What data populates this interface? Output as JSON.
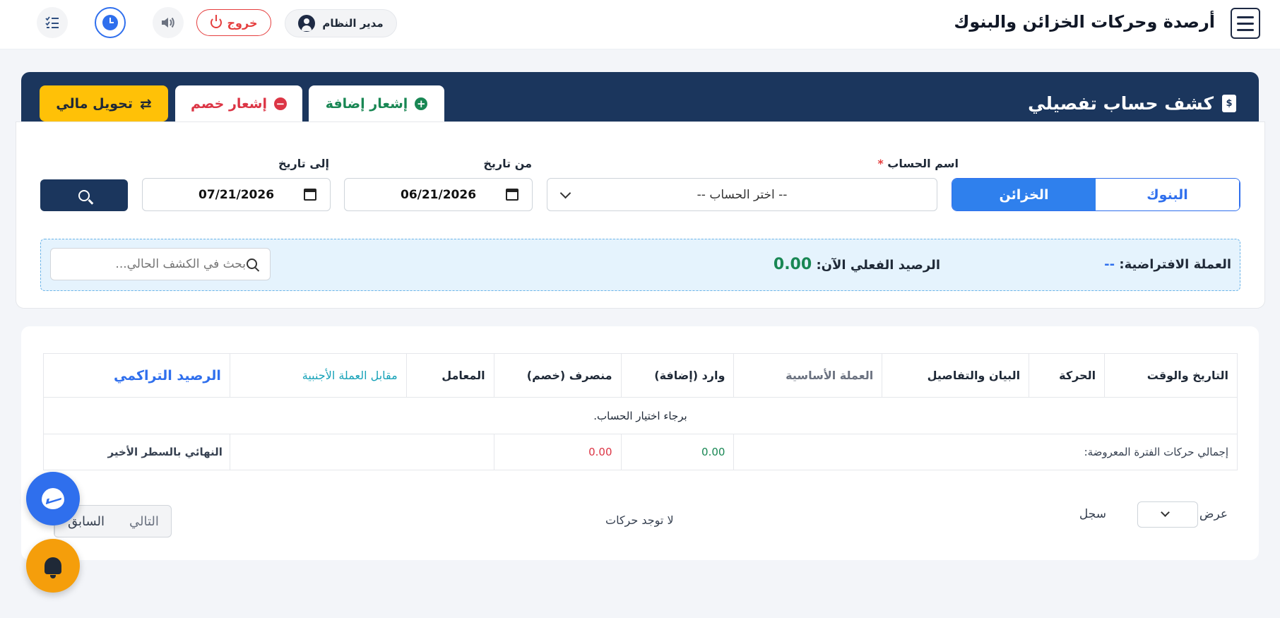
{
  "topbar": {
    "title": "أرصدة وحركات الخزائن والبنوك",
    "user_label": "مدير النظام",
    "logout_label": "خروج"
  },
  "header": {
    "section_title": "كشف حساب تفصيلي",
    "add_notice_label": "إشعار إضافة",
    "deduct_notice_label": "إشعار خصم",
    "transfer_label": "تحويل مالي",
    "doc_icon_text": "$"
  },
  "filters": {
    "type_options": [
      "الخزائن",
      "البنوك"
    ],
    "active_type": "الخزائن",
    "account_label": "اسم الحساب",
    "required_mark": "*",
    "account_placeholder": "-- اختر الحساب --",
    "from_label": "من تاريخ",
    "from_value": "06/21/2026",
    "to_label": "إلى تاريخ",
    "to_value": "07/21/2026"
  },
  "info": {
    "currency_label": "العملة الافتراضية:",
    "currency_value": "--",
    "balance_label": "الرصيد الفعلي الآن:",
    "balance_value": "0.00",
    "search_placeholder": "بحث في الكشف الحالي..."
  },
  "table": {
    "columns": {
      "date": "التاريخ والوقت",
      "movement": "الحركة",
      "description": "البيان والتفاصيل",
      "base_currency": "العملة الأساسية",
      "incoming": "وارد (إضافة)",
      "outgoing": "منصرف (خصم)",
      "party": "المعامل",
      "foreign_equiv": "مقابل العملة الأجنبية",
      "cumulative": "الرصيد التراكمي"
    },
    "empty_message": "برجاء اختيار الحساب.",
    "totals": {
      "label": "إجمالي حركات الفترة المعروضة:",
      "incoming": "0.00",
      "outgoing": "0.00",
      "final_label": "النهائي بالسطر الأخير"
    }
  },
  "footer": {
    "show_label": "عرض",
    "records_label": "سجل",
    "no_moves": "لا توجد حركات",
    "prev_label": "السابق",
    "next_label": "التالي"
  },
  "icons": {
    "menu": "hamburger-icon",
    "user": "user-circle-icon",
    "logout": "power-icon",
    "sound": "speaker-icon",
    "clock": "clock-icon",
    "list": "checklist-icon",
    "search": "search-icon",
    "calendar": "calendar-icon",
    "messenger": "messenger-icon",
    "bell": "bell-icon"
  },
  "colors": {
    "brand_navy": "#1b365d",
    "primary_blue": "#2f80ed",
    "success": "#198754",
    "danger": "#dc3545",
    "warning": "#ffc107"
  }
}
